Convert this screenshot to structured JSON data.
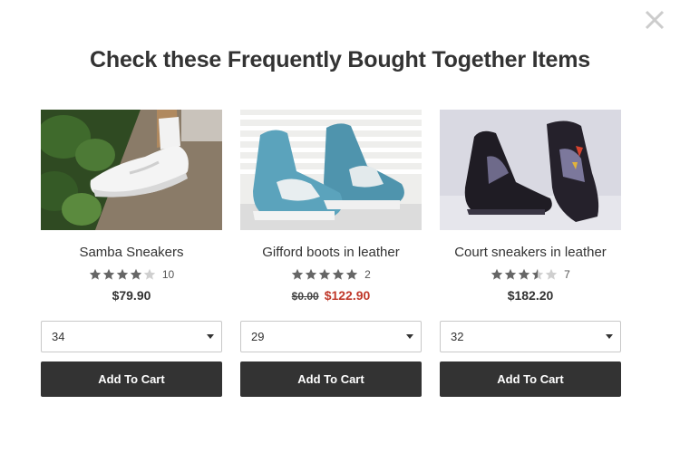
{
  "modal": {
    "title": "Check these Frequently Bought Together Items"
  },
  "colors": {
    "button_bg": "#333333",
    "sale_price": "#c0392b",
    "star_filled": "#666666",
    "star_empty": "#cfcfcf"
  },
  "products": [
    {
      "name": "Samba Sneakers",
      "image_icon": "white-sneaker-photo",
      "rating": 4,
      "rating_count": "10",
      "old_price": "",
      "price": "$79.90",
      "size": "34",
      "button_label": "Add To Cart"
    },
    {
      "name": "Gifford boots in leather",
      "image_icon": "teal-hightop-photo",
      "rating": 5,
      "rating_count": "2",
      "old_price": "$0.00",
      "price": "$122.90",
      "size": "29",
      "button_label": "Add To Cart"
    },
    {
      "name": "Court sneakers in leather",
      "image_icon": "black-hightop-photo",
      "rating": 3.5,
      "rating_count": "7",
      "old_price": "",
      "price": "$182.20",
      "size": "32",
      "button_label": "Add To Cart"
    }
  ]
}
